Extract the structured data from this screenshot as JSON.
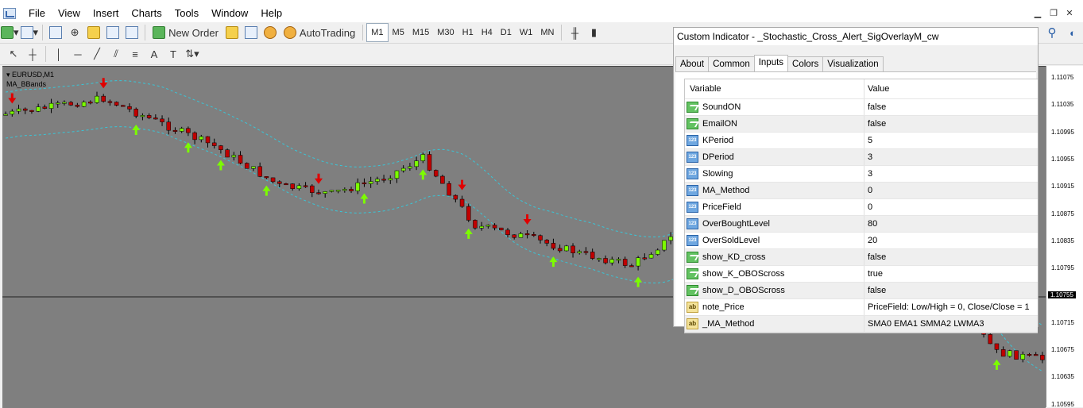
{
  "menu": {
    "items": [
      "File",
      "View",
      "Insert",
      "Charts",
      "Tools",
      "Window",
      "Help"
    ]
  },
  "toolbar": {
    "new_order_label": "New Order",
    "autotrading_label": "AutoTrading",
    "timeframes": [
      "M1",
      "M5",
      "M15",
      "M30",
      "H1",
      "H4",
      "D1",
      "W1",
      "MN"
    ],
    "active_timeframe": "M1"
  },
  "chart": {
    "symbol_label": "EURUSD,M1",
    "indicator_label": "MA_BBands",
    "background_color": "#7f7f7f",
    "bull_color": "#7cfc00",
    "bear_color": "#c00000",
    "band_color": "#38c6d8",
    "price_ticks": [
      "1.11075",
      "1.11035",
      "1.10995",
      "1.10955",
      "1.10915",
      "1.10875",
      "1.10835",
      "1.10795",
      "1.10755",
      "1.10715",
      "1.10675",
      "1.10635",
      "1.10595"
    ],
    "current_price": "1.10755"
  },
  "dialog": {
    "title": "Custom Indicator - _Stochastic_Cross_Alert_SigOverlayM_cw",
    "tabs": [
      "About",
      "Common",
      "Inputs",
      "Colors",
      "Visualization"
    ],
    "active_tab": "Inputs",
    "col_variable": "Variable",
    "col_value": "Value",
    "params": [
      {
        "type": "bool",
        "name": "SoundON",
        "value": "false"
      },
      {
        "type": "bool",
        "name": "EmailON",
        "value": "false"
      },
      {
        "type": "int",
        "name": "KPeriod",
        "value": "5"
      },
      {
        "type": "int",
        "name": "DPeriod",
        "value": "3"
      },
      {
        "type": "int",
        "name": "Slowing",
        "value": "3"
      },
      {
        "type": "int",
        "name": "MA_Method",
        "value": "0"
      },
      {
        "type": "int",
        "name": "PriceField",
        "value": "0"
      },
      {
        "type": "int",
        "name": "OverBoughtLevel",
        "value": "80"
      },
      {
        "type": "int",
        "name": "OverSoldLevel",
        "value": "20"
      },
      {
        "type": "bool",
        "name": "show_KD_cross",
        "value": "false"
      },
      {
        "type": "bool",
        "name": "show_K_OBOScross",
        "value": "true"
      },
      {
        "type": "bool",
        "name": "show_D_OBOScross",
        "value": "false"
      },
      {
        "type": "str",
        "name": "note_Price",
        "value": "PriceField:  Low/High = 0, Close/Close = 1"
      },
      {
        "type": "str",
        "name": "_MA_Method",
        "value": "SMA0 EMA1 SMMA2 LWMA3"
      }
    ]
  }
}
